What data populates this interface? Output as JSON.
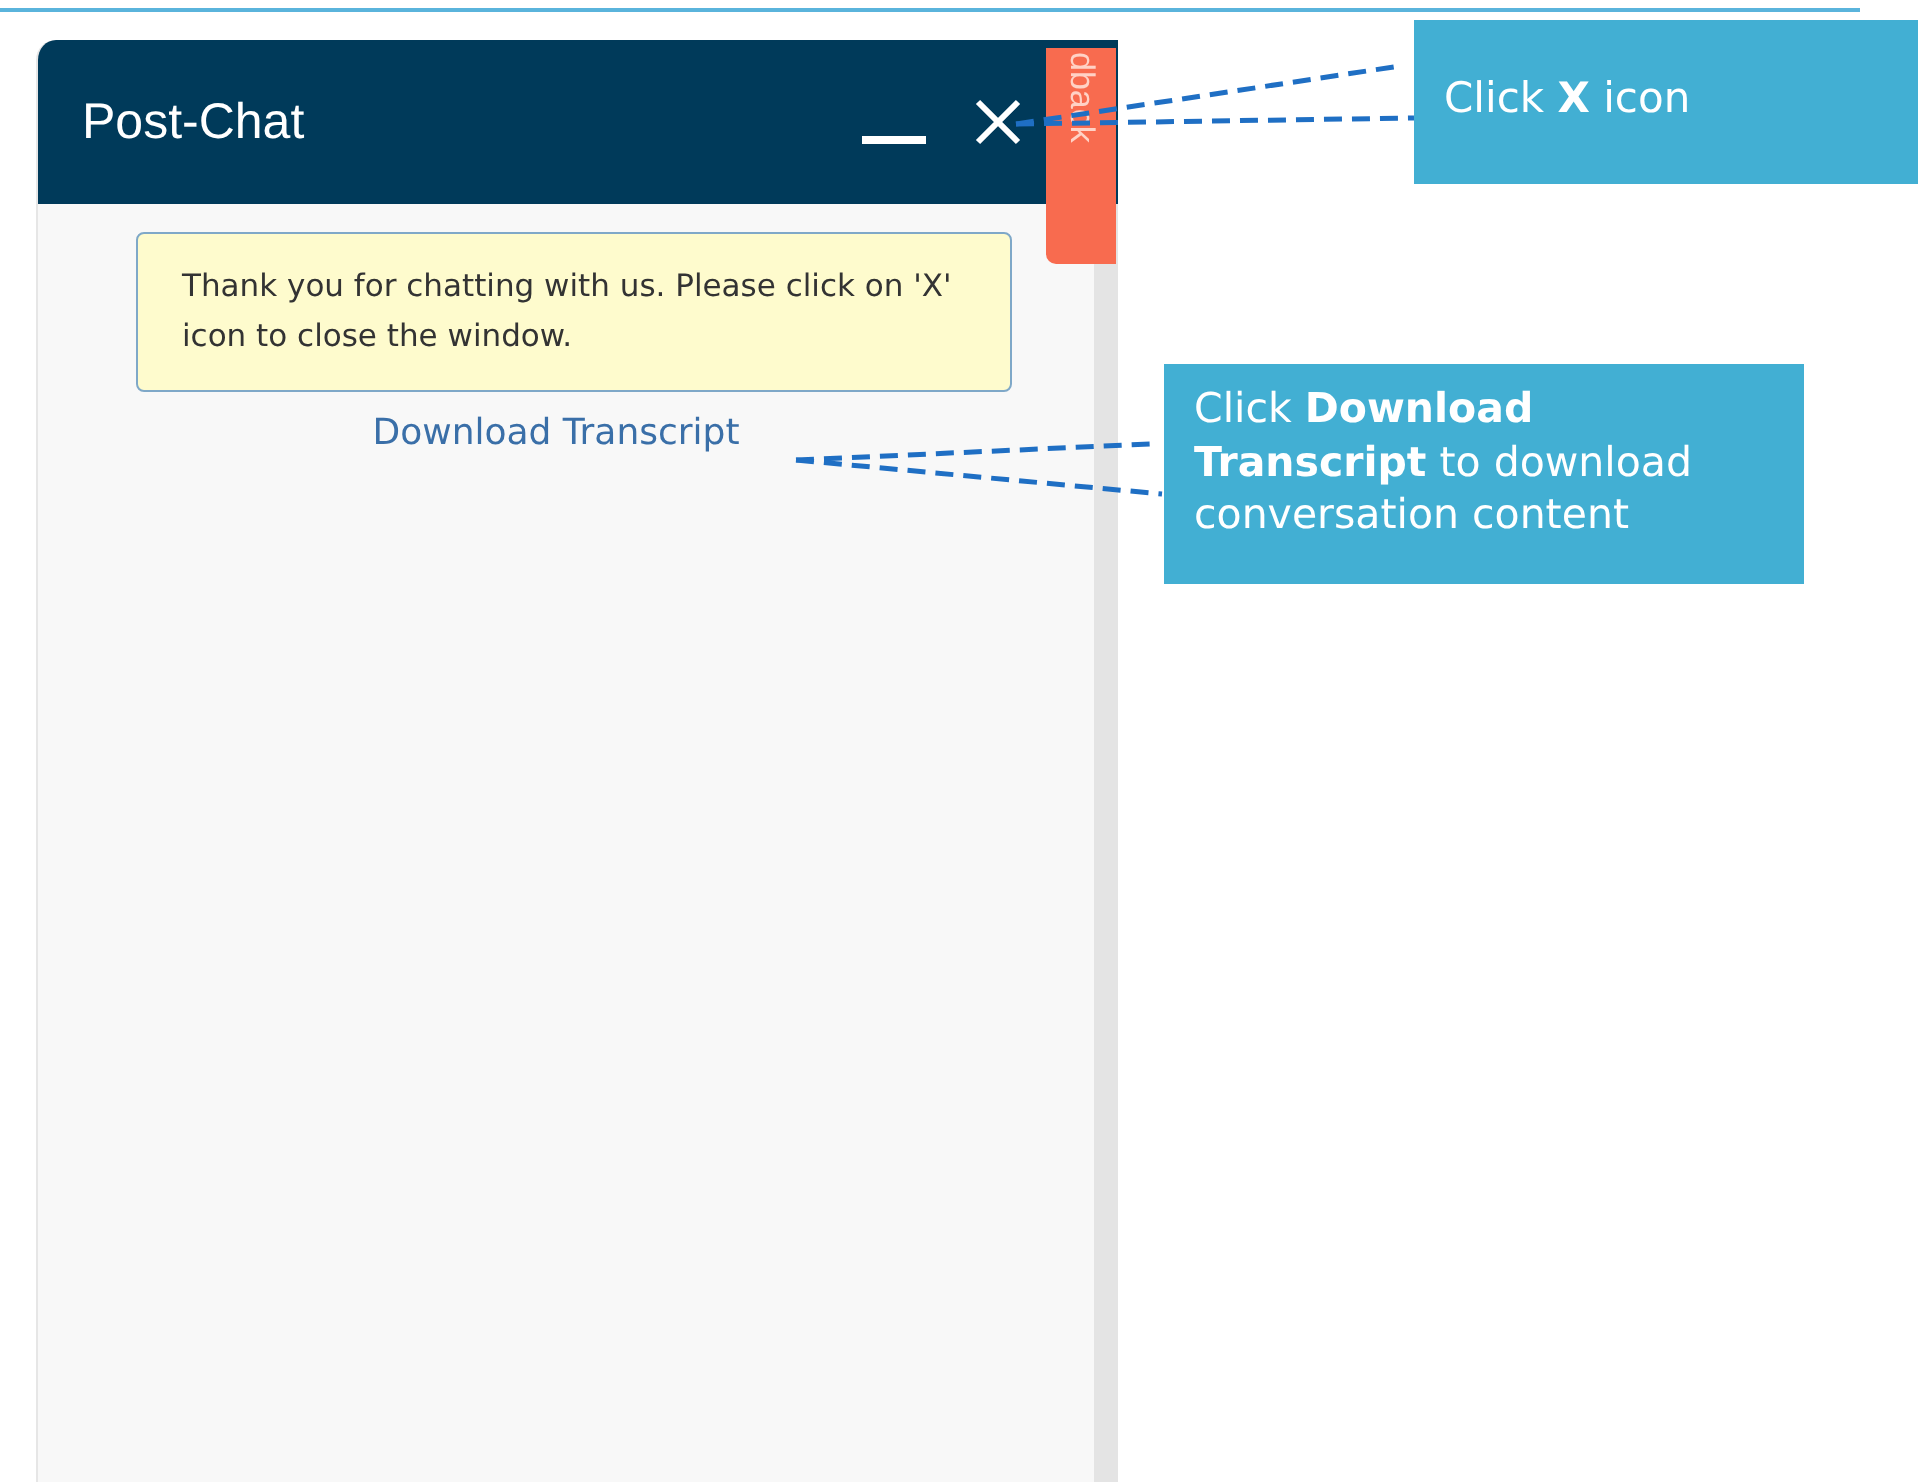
{
  "chat_window": {
    "title": "Post-Chat",
    "notice": "Thank you for chatting with us. Please click on 'X' icon to close the window.",
    "link": "Download Transcript"
  },
  "side_tab": {
    "label": "dback"
  },
  "callouts": [
    {
      "text": "Click **X** icon"
    },
    {
      "text": "Click  **Download Transcript** to download conversation content"
    }
  ]
}
